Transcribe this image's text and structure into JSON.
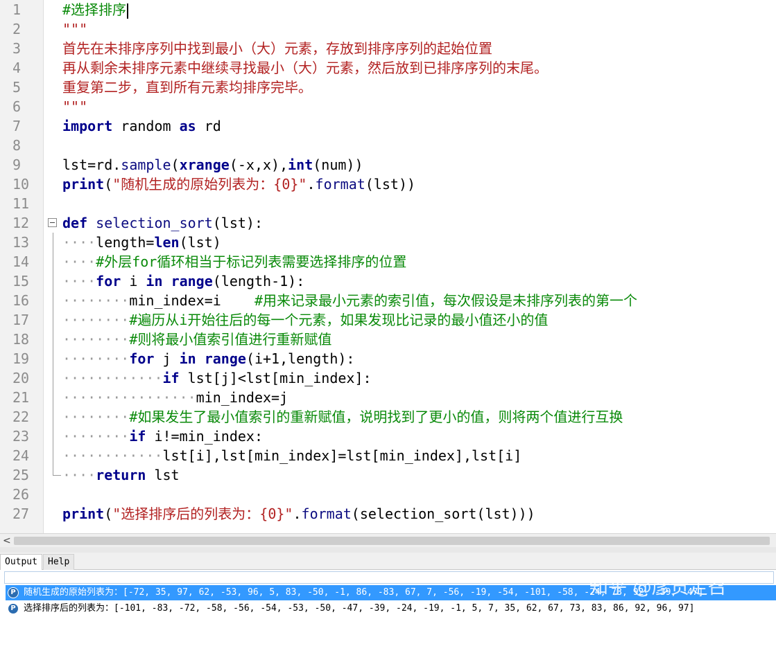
{
  "editor": {
    "lines": [
      {
        "n": "1",
        "t": [
          {
            "c": "cmt",
            "s": "#选择排序"
          }
        ],
        "caret": true
      },
      {
        "n": "2",
        "t": [
          {
            "c": "str",
            "s": "\"\"\""
          }
        ]
      },
      {
        "n": "3",
        "t": [
          {
            "c": "str",
            "s": "首先在未排序序列中找到最小（大）元素，存放到排序序列的起始位置"
          }
        ]
      },
      {
        "n": "4",
        "t": [
          {
            "c": "str",
            "s": "再从剩余未排序元素中继续寻找最小（大）元素，然后放到已排序序列的末尾。"
          }
        ]
      },
      {
        "n": "5",
        "t": [
          {
            "c": "str",
            "s": "重复第二步，直到所有元素均排序完毕。"
          }
        ]
      },
      {
        "n": "6",
        "t": [
          {
            "c": "str",
            "s": "\"\"\""
          }
        ]
      },
      {
        "n": "7",
        "t": [
          {
            "c": "kw",
            "s": "import"
          },
          {
            "c": "",
            "s": " random "
          },
          {
            "c": "kw",
            "s": "as"
          },
          {
            "c": "",
            "s": " rd"
          }
        ]
      },
      {
        "n": "8",
        "t": []
      },
      {
        "n": "9",
        "t": [
          {
            "c": "",
            "s": "lst=rd."
          },
          {
            "c": "bi",
            "s": "sample"
          },
          {
            "c": "",
            "s": "("
          },
          {
            "c": "kw",
            "s": "xrange"
          },
          {
            "c": "",
            "s": "(-x,x),"
          },
          {
            "c": "kw",
            "s": "int"
          },
          {
            "c": "",
            "s": "(num))"
          }
        ]
      },
      {
        "n": "10",
        "t": [
          {
            "c": "kw",
            "s": "print"
          },
          {
            "c": "",
            "s": "("
          },
          {
            "c": "str",
            "s": "\"随机生成的原始列表为：{0}\""
          },
          {
            "c": "",
            "s": "."
          },
          {
            "c": "bi",
            "s": "format"
          },
          {
            "c": "",
            "s": "(lst))"
          }
        ]
      },
      {
        "n": "11",
        "t": []
      },
      {
        "n": "12",
        "t": [
          {
            "c": "kw",
            "s": "def"
          },
          {
            "c": "",
            "s": " "
          },
          {
            "c": "bi",
            "s": "selection_sort"
          },
          {
            "c": "",
            "s": "(lst):"
          }
        ]
      },
      {
        "n": "13",
        "t": [
          {
            "c": "ws",
            "s": "····"
          },
          {
            "c": "",
            "s": "length="
          },
          {
            "c": "kw",
            "s": "len"
          },
          {
            "c": "",
            "s": "(lst)"
          }
        ]
      },
      {
        "n": "14",
        "t": [
          {
            "c": "ws",
            "s": "····"
          },
          {
            "c": "cmt",
            "s": "#外层for循环相当于标记列表需要选择排序的位置"
          }
        ]
      },
      {
        "n": "15",
        "t": [
          {
            "c": "ws",
            "s": "····"
          },
          {
            "c": "kw",
            "s": "for"
          },
          {
            "c": "",
            "s": " i "
          },
          {
            "c": "kw",
            "s": "in"
          },
          {
            "c": "",
            "s": " "
          },
          {
            "c": "kw",
            "s": "range"
          },
          {
            "c": "",
            "s": "(length-1):"
          }
        ]
      },
      {
        "n": "16",
        "t": [
          {
            "c": "ws",
            "s": "········"
          },
          {
            "c": "",
            "s": "min_index=i    "
          },
          {
            "c": "cmt",
            "s": "#用来记录最小元素的索引值，每次假设是未排序列表的第一个"
          }
        ]
      },
      {
        "n": "17",
        "t": [
          {
            "c": "ws",
            "s": "········"
          },
          {
            "c": "cmt",
            "s": "#遍历从i开始往后的每一个元素，如果发现比记录的最小值还小的值"
          }
        ]
      },
      {
        "n": "18",
        "t": [
          {
            "c": "ws",
            "s": "········"
          },
          {
            "c": "cmt",
            "s": "#则将最小值索引值进行重新赋值"
          }
        ]
      },
      {
        "n": "19",
        "t": [
          {
            "c": "ws",
            "s": "········"
          },
          {
            "c": "kw",
            "s": "for"
          },
          {
            "c": "",
            "s": " j "
          },
          {
            "c": "kw",
            "s": "in"
          },
          {
            "c": "",
            "s": " "
          },
          {
            "c": "kw",
            "s": "range"
          },
          {
            "c": "",
            "s": "(i+1,length):"
          }
        ]
      },
      {
        "n": "20",
        "t": [
          {
            "c": "ws",
            "s": "············"
          },
          {
            "c": "kw",
            "s": "if"
          },
          {
            "c": "",
            "s": " lst[j]<lst[min_index]:"
          }
        ]
      },
      {
        "n": "21",
        "t": [
          {
            "c": "ws",
            "s": "················"
          },
          {
            "c": "",
            "s": "min_index=j"
          }
        ]
      },
      {
        "n": "22",
        "t": [
          {
            "c": "ws",
            "s": "········"
          },
          {
            "c": "cmt",
            "s": "#如果发生了最小值索引的重新赋值，说明找到了更小的值，则将两个值进行互换"
          }
        ]
      },
      {
        "n": "23",
        "t": [
          {
            "c": "ws",
            "s": "········"
          },
          {
            "c": "kw",
            "s": "if"
          },
          {
            "c": "",
            "s": " i!=min_index:"
          }
        ]
      },
      {
        "n": "24",
        "t": [
          {
            "c": "ws",
            "s": "············"
          },
          {
            "c": "",
            "s": "lst[i],lst[min_index]=lst[min_index],lst[i]"
          }
        ]
      },
      {
        "n": "25",
        "t": [
          {
            "c": "ws",
            "s": "····"
          },
          {
            "c": "kw",
            "s": "return"
          },
          {
            "c": "",
            "s": " lst"
          }
        ]
      },
      {
        "n": "26",
        "t": []
      },
      {
        "n": "27",
        "t": [
          {
            "c": "kw",
            "s": "print"
          },
          {
            "c": "",
            "s": "("
          },
          {
            "c": "str",
            "s": "\"选择排序后的列表为：{0}\""
          },
          {
            "c": "",
            "s": "."
          },
          {
            "c": "bi",
            "s": "format"
          },
          {
            "c": "",
            "s": "(selection_sort(lst)))"
          }
        ]
      }
    ]
  },
  "panel": {
    "tab_output": "Output",
    "tab_help": "Help",
    "output_line1": "随机生成的原始列表为：[-72, 35, 97, 62, -53, 96, 5, 83, -50, -1, 86, -83, 67, 7, -56, -19, -54, -101, -58, -24, 73, 92, -39, -47]",
    "output_line2": "选择排序后的列表为：[-101, -83, -72, -58, -56, -54, -53, -50, -47, -39, -24, -19, -1, 5, 7, 35, 62, 67, 73, 83, 86, 92, 96, 97]",
    "output_icon": "P"
  },
  "scrollbar": {
    "left_arrow": "<"
  },
  "watermark": "知乎 @彦贡走召",
  "icons": {
    "fold": "fold-minus-icon",
    "output": "python-output-icon"
  }
}
